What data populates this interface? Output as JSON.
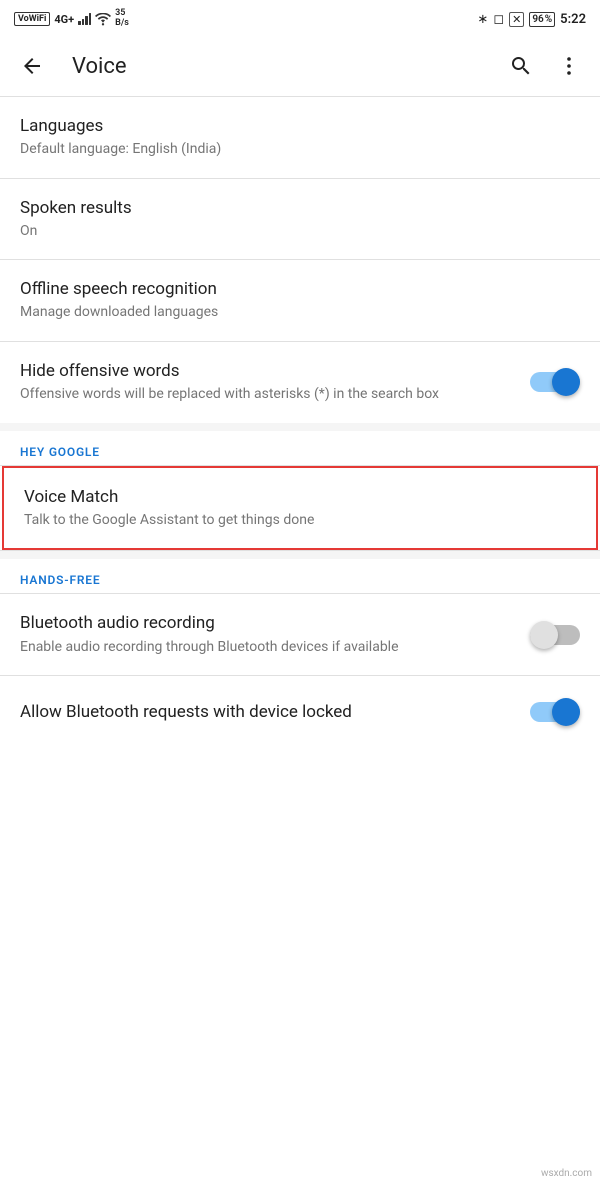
{
  "statusBar": {
    "leftItems": {
      "wifiLabel": "VoWiFi",
      "signal": "4G+",
      "speed": "35\nB/s"
    },
    "rightItems": {
      "battery": "96",
      "time": "5:22"
    }
  },
  "appBar": {
    "title": "Voice",
    "backLabel": "←",
    "searchLabel": "search",
    "moreLabel": "more options"
  },
  "settings": {
    "items": [
      {
        "id": "languages",
        "title": "Languages",
        "subtitle": "Default language: English (India)",
        "hasToggle": false,
        "toggleOn": false
      },
      {
        "id": "spoken-results",
        "title": "Spoken results",
        "subtitle": "On",
        "hasToggle": false,
        "toggleOn": false
      },
      {
        "id": "offline-speech",
        "title": "Offline speech recognition",
        "subtitle": "Manage downloaded languages",
        "hasToggle": false,
        "toggleOn": false
      },
      {
        "id": "hide-offensive",
        "title": "Hide offensive words",
        "subtitle": "Offensive words will be replaced with asterisks (*) in the search box",
        "hasToggle": true,
        "toggleOn": true
      }
    ],
    "sections": [
      {
        "id": "hey-google",
        "label": "HEY GOOGLE",
        "items": [
          {
            "id": "voice-match",
            "title": "Voice Match",
            "subtitle": "Talk to the Google Assistant to get things done",
            "hasToggle": false,
            "toggleOn": false,
            "highlighted": true
          }
        ]
      },
      {
        "id": "hands-free",
        "label": "HANDS-FREE",
        "items": [
          {
            "id": "bluetooth-audio",
            "title": "Bluetooth audio recording",
            "subtitle": "Enable audio recording through Bluetooth devices if available",
            "hasToggle": true,
            "toggleOn": false
          },
          {
            "id": "bluetooth-locked",
            "title": "Allow Bluetooth requests with device locked",
            "subtitle": "",
            "hasToggle": true,
            "toggleOn": true
          }
        ]
      }
    ]
  },
  "watermark": "wsxdn.com"
}
